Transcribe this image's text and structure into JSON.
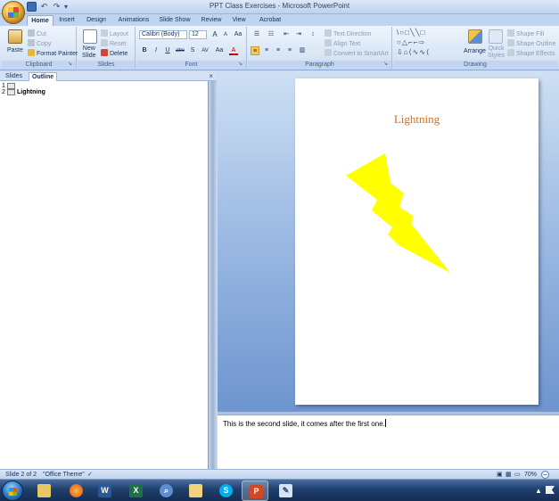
{
  "window": {
    "title": "PPT Class Exercises - Microsoft PowerPoint"
  },
  "quick_access": {
    "undo_glyph": "↶",
    "redo_glyph": "↷",
    "more_glyph": "▾"
  },
  "ribbon_tabs": [
    "Home",
    "Insert",
    "Design",
    "Animations",
    "Slide Show",
    "Review",
    "View",
    "Acrobat"
  ],
  "ribbon": {
    "clipboard": {
      "label": "Clipboard",
      "paste": "Paste",
      "cut": "Cut",
      "copy": "Copy",
      "format_painter": "Format Painter"
    },
    "slides": {
      "label": "Slides",
      "new_slide_line1": "New",
      "new_slide_line2": "Slide",
      "layout": "Layout",
      "reset": "Reset",
      "delete": "Delete"
    },
    "font": {
      "label": "Font",
      "font_name": "Calibri (Body)",
      "font_size": "12",
      "grow": "A",
      "shrink": "A",
      "clear": "Aa",
      "bold": "B",
      "italic": "I",
      "underline": "U",
      "strike": "abe",
      "shadow": "S",
      "spacing": "AV",
      "change_case": "Aa",
      "font_color": "A"
    },
    "paragraph": {
      "label": "Paragraph",
      "text_direction": "Text Direction",
      "align_text": "Align Text",
      "convert_smartart": "Convert to SmartArt"
    },
    "drawing": {
      "label": "Drawing",
      "shapes_row1": "\\○□╲╲□",
      "shapes_row2": "○△⌐⌐⇨",
      "shapes_row3": "⇩⌂⟨∿∿⟨",
      "arrange": "Arrange",
      "quick_styles_line1": "Quick",
      "quick_styles_line2": "Styles",
      "shape_fill": "Shape Fill",
      "shape_outline": "Shape Outline",
      "shape_effects": "Shape Effects"
    }
  },
  "left_pane": {
    "tabs": [
      "Slides",
      "Outline"
    ],
    "close": "×",
    "outline": [
      {
        "num": "1",
        "title": ""
      },
      {
        "num": "2",
        "title": "Lightning"
      }
    ]
  },
  "slide": {
    "title": "Lightning",
    "title_color": "#e46c0a",
    "shape_color": "#ffff00"
  },
  "notes": {
    "text": "This is the second slide, it comes after the first one."
  },
  "status": {
    "slide_indicator": "Slide 2 of 2",
    "theme": "\"Office Theme\"",
    "zoom": "70%",
    "zoom_out": "−"
  },
  "taskbar": {
    "apps": [
      "start",
      "explorer",
      "firefox",
      "word",
      "excel",
      "search",
      "folder",
      "skype",
      "powerpoint",
      "paint"
    ]
  }
}
